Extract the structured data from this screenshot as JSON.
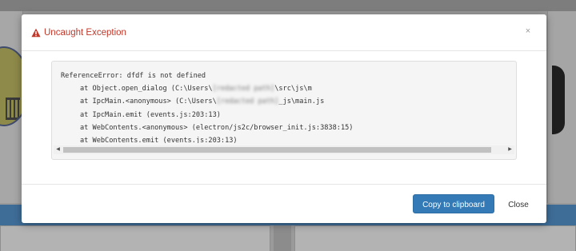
{
  "dialog": {
    "title": "Uncaught Exception",
    "close_glyph": "×",
    "icon": "warning-icon",
    "title_color": "#c0392b"
  },
  "trace": {
    "error": "ReferenceError: dfdf is not defined",
    "lines": [
      {
        "prefix": "at Object.open_dialog (C:\\Users\\",
        "redacted": "[redacted path]",
        "suffix": "\\src\\js\\m"
      },
      {
        "prefix": "at IpcMain.<anonymous> (C:\\Users\\",
        "redacted": "[redacted path]",
        "suffix": "_js\\main.js"
      },
      {
        "prefix": "at IpcMain.emit (events.js:203:13)",
        "redacted": "",
        "suffix": ""
      },
      {
        "prefix": "at WebContents.<anonymous> (electron/js2c/browser_init.js:3838:15)",
        "redacted": "",
        "suffix": ""
      },
      {
        "prefix": "at WebContents.emit (events.js:203:13)",
        "redacted": "",
        "suffix": ""
      }
    ]
  },
  "scrollbar": {
    "left_arrow": "◀",
    "right_arrow": "▶"
  },
  "footer": {
    "copy_label": "Copy to clipboard",
    "close_label": "Close",
    "primary_color": "#337ab7"
  }
}
